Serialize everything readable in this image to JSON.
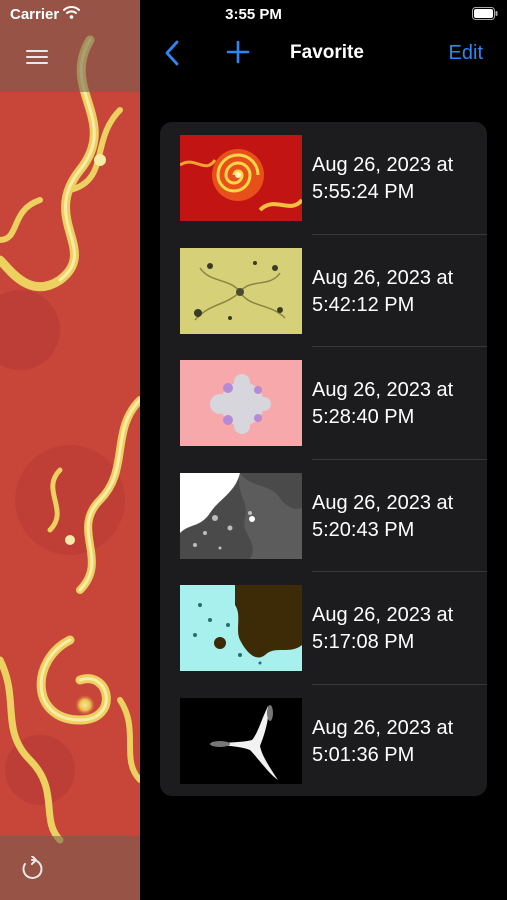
{
  "status_bar": {
    "carrier": "Carrier",
    "time": "3:55 PM"
  },
  "nav": {
    "title": "Favorite",
    "edit_label": "Edit",
    "back_icon": "chevron-left-icon",
    "add_icon": "plus-icon"
  },
  "sidebar": {
    "menu_icon": "hamburger-menu-icon",
    "refresh_icon": "refresh-icon"
  },
  "favorites": [
    {
      "date": "Aug 26, 2023 at",
      "time": "5:55:24 PM",
      "thumbnail": "red-spiral-fractal"
    },
    {
      "date": "Aug 26, 2023 at",
      "time": "5:42:12 PM",
      "thumbnail": "yellow-spiral-fractal"
    },
    {
      "date": "Aug 26, 2023 at",
      "time": "5:28:40 PM",
      "thumbnail": "pink-mandelbrot-fractal"
    },
    {
      "date": "Aug 26, 2023 at",
      "time": "5:20:43 PM",
      "thumbnail": "grayscale-fractal"
    },
    {
      "date": "Aug 26, 2023 at",
      "time": "5:17:08 PM",
      "thumbnail": "cyan-brown-fractal"
    },
    {
      "date": "Aug 26, 2023 at",
      "time": "5:01:36 PM",
      "thumbnail": "black-white-fractal"
    }
  ],
  "colors": {
    "accent": "#2e86f5",
    "card_bg": "#1c1c1e",
    "fractal_red": "#c8453a",
    "fractal_yellow": "#f0d060"
  }
}
